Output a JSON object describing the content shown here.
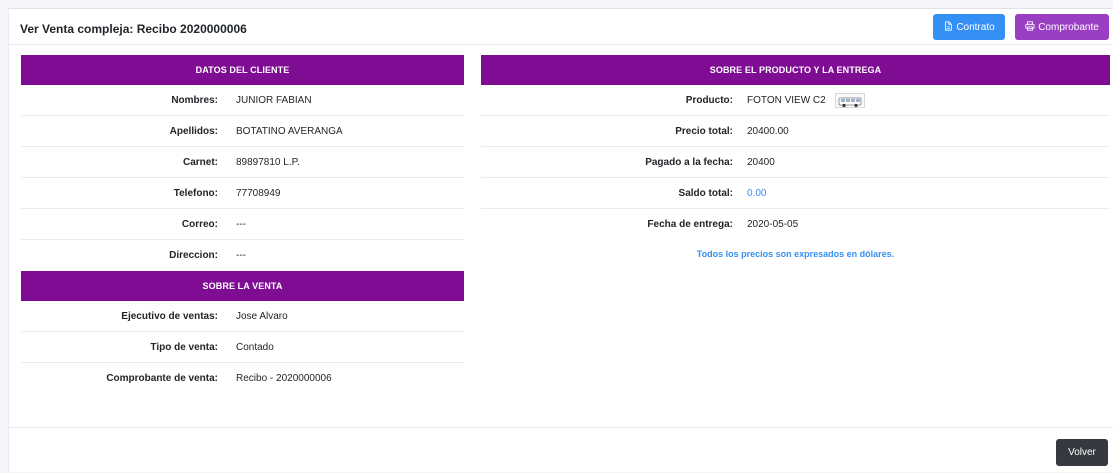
{
  "header": {
    "title": "Ver Venta compleja: Recibo 2020000006",
    "contrato_label": "Contrato",
    "comprobante_label": "Comprobante",
    "contrato_icon": "file-icon",
    "comprobante_icon": "printer-icon",
    "contrato_color": "#3490f5",
    "comprobante_color": "#9a3fc4"
  },
  "cliente": {
    "heading": "DATOS DEL CLIENTE",
    "rows": [
      {
        "label": "Nombres:",
        "value": "JUNIOR FABIAN"
      },
      {
        "label": "Apellidos:",
        "value": "BOTATINO AVERANGA"
      },
      {
        "label": "Carnet:",
        "value": "89897810 L.P."
      },
      {
        "label": "Telefono:",
        "value": "77708949"
      },
      {
        "label": "Correo:",
        "value": "---"
      },
      {
        "label": "Direccion:",
        "value": "---"
      }
    ]
  },
  "venta": {
    "heading": "SOBRE LA VENTA",
    "rows": [
      {
        "label": "Ejecutivo de ventas:",
        "value": "Jose Alvaro"
      },
      {
        "label": "Tipo de venta:",
        "value": "Contado"
      },
      {
        "label": "Comprobante de venta:",
        "value": "Recibo - 2020000006"
      }
    ]
  },
  "producto": {
    "heading": "SOBRE EL PRODUCTO Y LA ENTREGA",
    "rows": [
      {
        "label": "Producto:",
        "value": "FOTON VIEW C2"
      },
      {
        "label": "Precio total:",
        "value": "20400.00"
      },
      {
        "label": "Pagado a la fecha:",
        "value": "20400"
      },
      {
        "label": "Saldo total:",
        "value": "0.00"
      },
      {
        "label": "Fecha de entrega:",
        "value": "2020-05-05"
      }
    ],
    "note": "Todos los precios son expresados en dólares."
  },
  "footer": {
    "volver_label": "Volver"
  },
  "colors": {
    "section_header": "#7f0d94",
    "link_blue": "#3490f5",
    "dark_button": "#343a40"
  }
}
